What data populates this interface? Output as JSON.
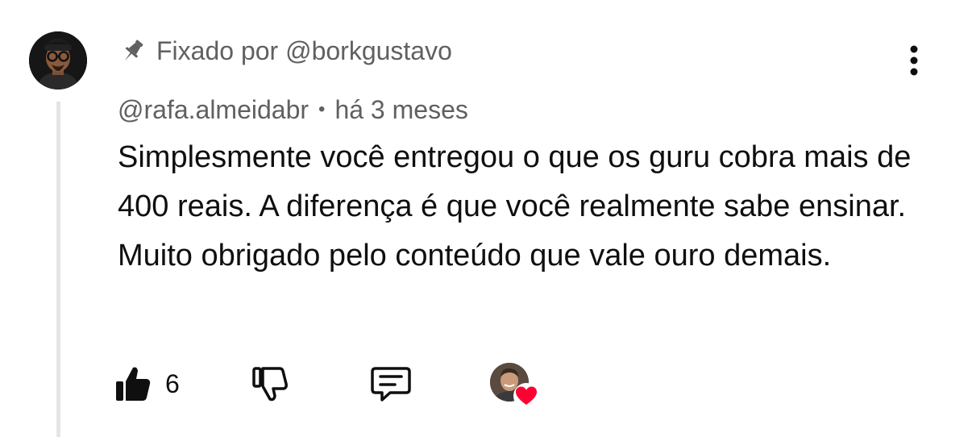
{
  "pinned": {
    "icon": "pin-icon",
    "label": "Fixado por @borkgustavo"
  },
  "comment": {
    "author": "@rafa.almeidabr",
    "separator": "•",
    "timestamp": "há 3 meses",
    "text": "Simplesmente você entregou o que os guru cobra mais de 400 reais. A diferença é que você realmente sabe ensinar. Muito obrigado pelo conteúdo que vale ouro demais."
  },
  "actions": {
    "like_count": "6",
    "like_icon": "thumbs-up-filled-icon",
    "dislike_icon": "thumbs-down-icon",
    "reply_icon": "reply-comment-icon",
    "menu_icon": "more-vertical-icon"
  },
  "colors": {
    "text_primary": "#0f0f0f",
    "text_secondary": "#606060",
    "thread_line": "#e5e5e5",
    "heart": "#ff0033"
  }
}
